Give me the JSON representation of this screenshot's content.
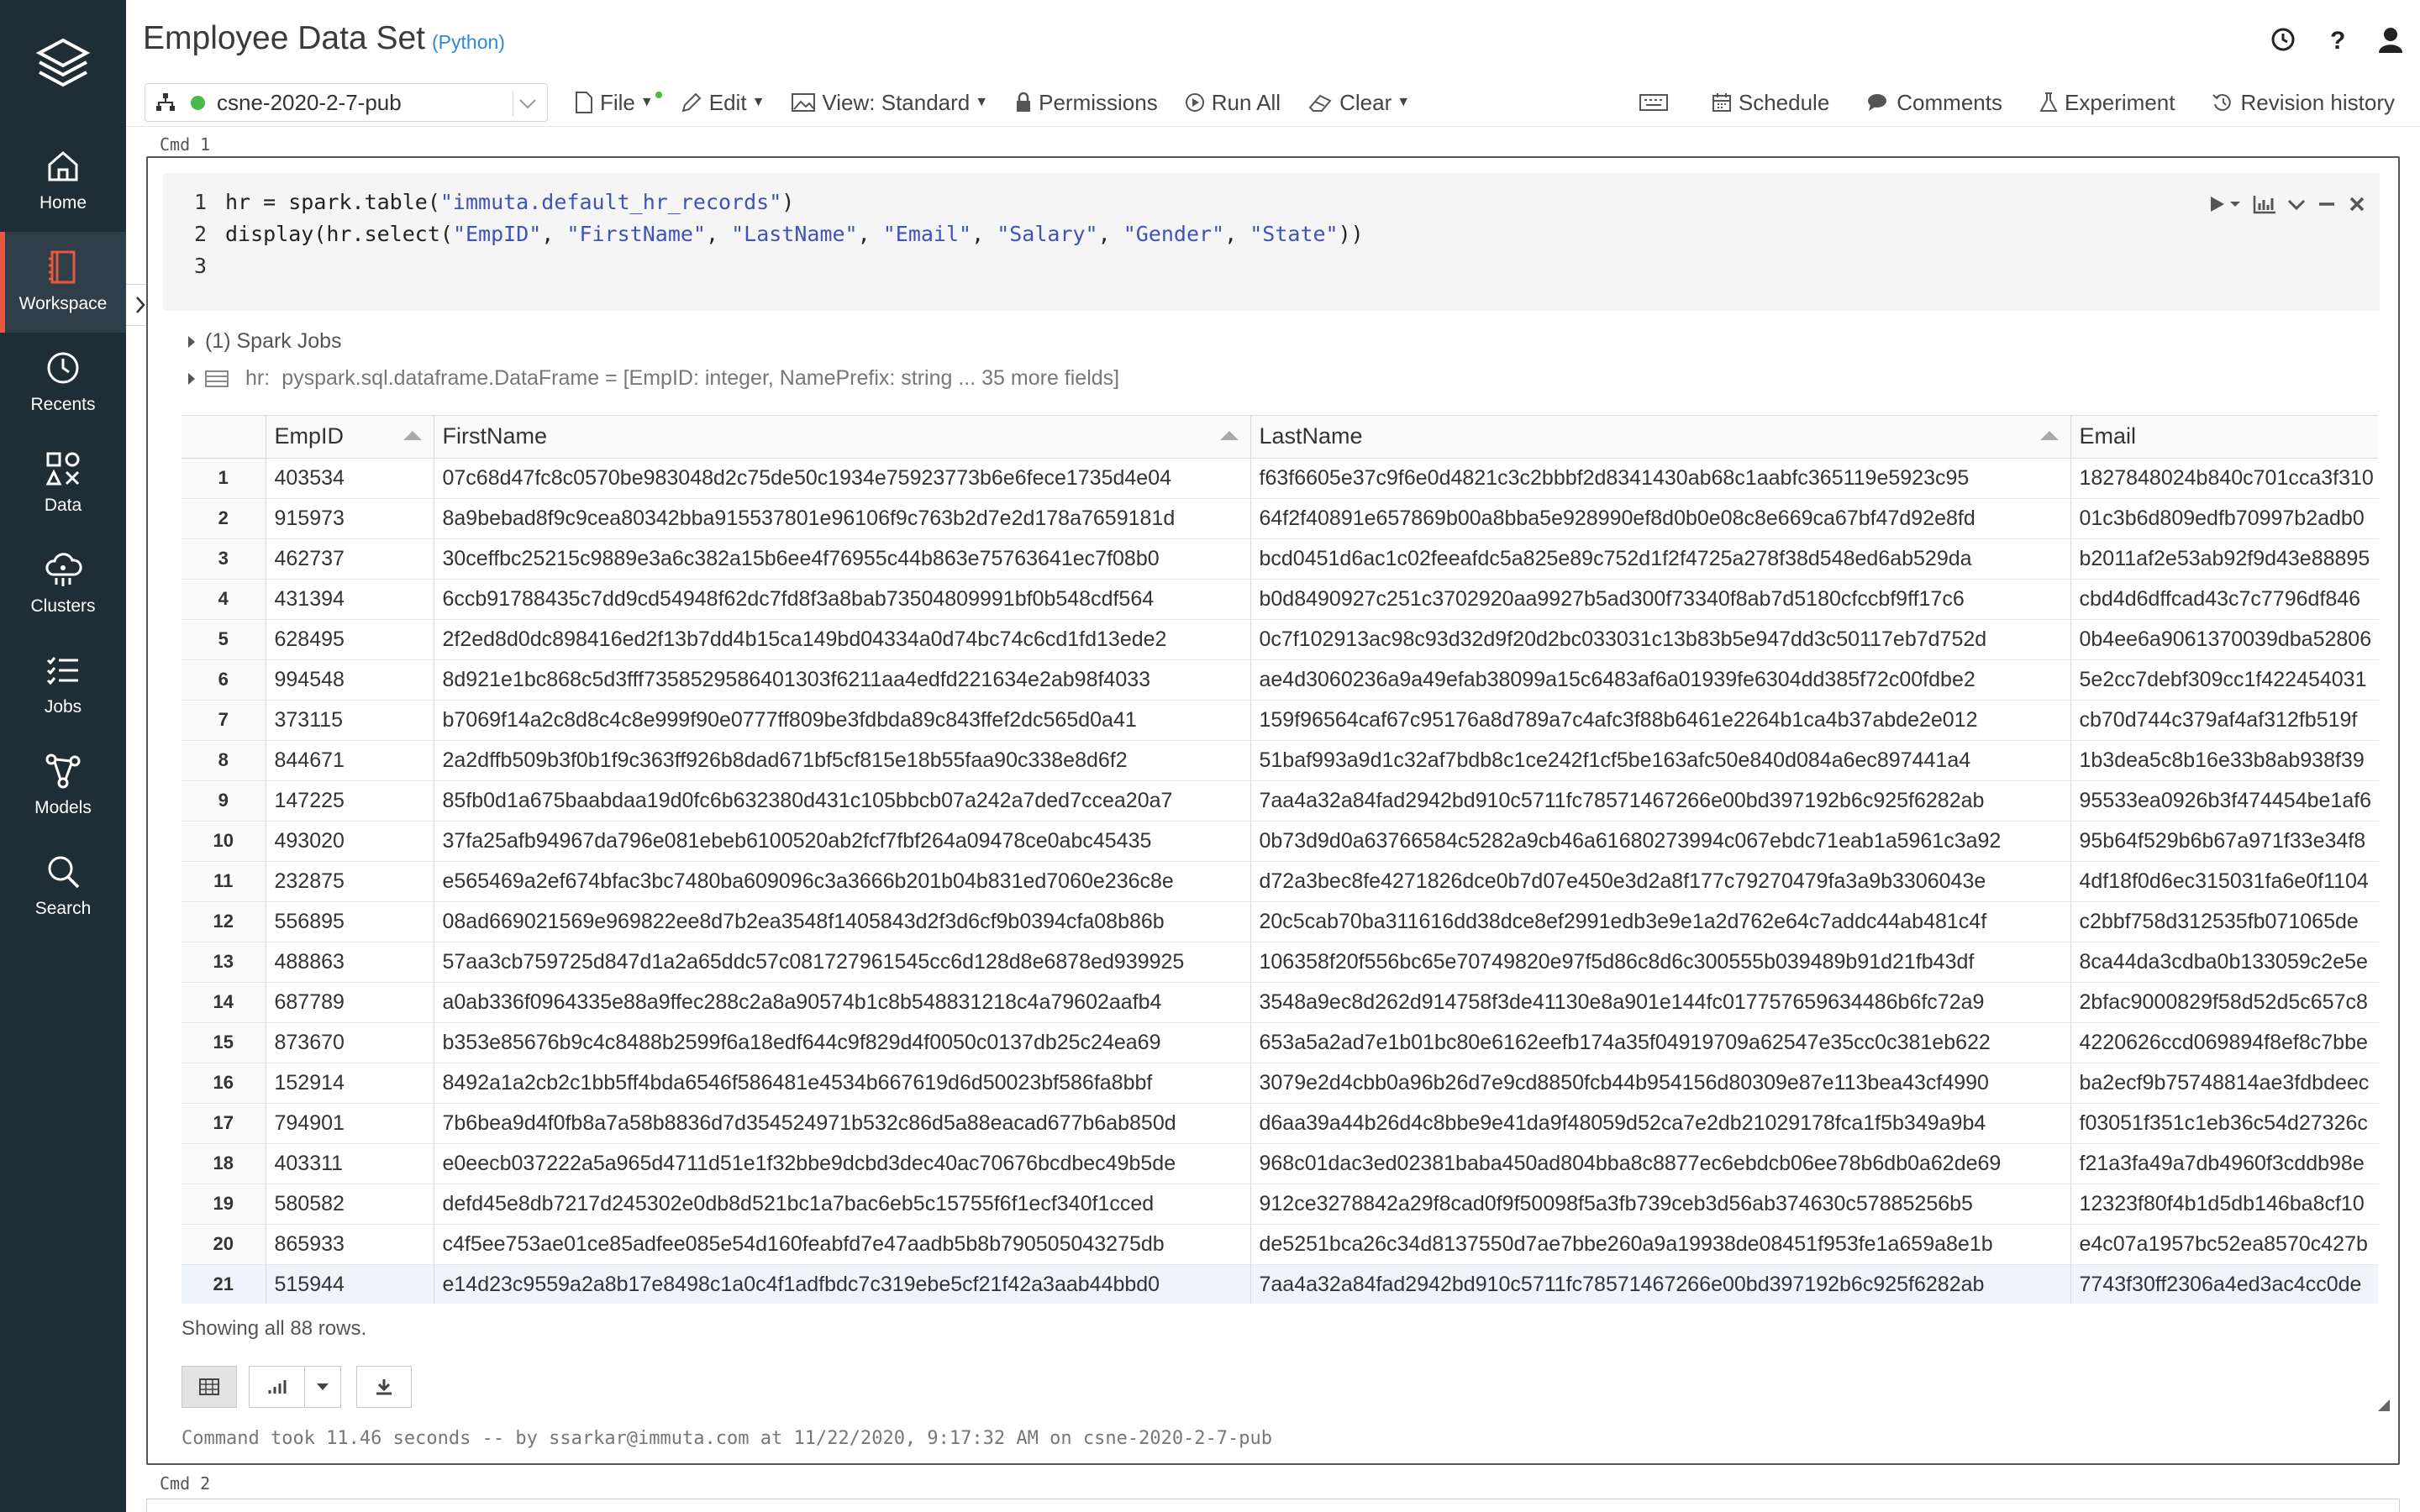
{
  "sidebar": {
    "items": [
      {
        "label": "Home",
        "icon": "home-icon",
        "active": false
      },
      {
        "label": "Workspace",
        "icon": "workspace-icon",
        "active": true
      },
      {
        "label": "Recents",
        "icon": "clock-icon",
        "active": false
      },
      {
        "label": "Data",
        "icon": "data-icon",
        "active": false
      },
      {
        "label": "Clusters",
        "icon": "clusters-icon",
        "active": false
      },
      {
        "label": "Jobs",
        "icon": "jobs-icon",
        "active": false
      },
      {
        "label": "Models",
        "icon": "models-icon",
        "active": false
      },
      {
        "label": "Search",
        "icon": "search-icon",
        "active": false
      }
    ]
  },
  "header": {
    "title": "Employee Data Set",
    "language": "(Python)"
  },
  "toolbar": {
    "cluster": "csne-2020-2-7-pub",
    "file": "File",
    "edit": "Edit",
    "view": "View: Standard",
    "permissions": "Permissions",
    "run_all": "Run All",
    "clear": "Clear",
    "schedule": "Schedule",
    "comments": "Comments",
    "experiment": "Experiment",
    "revision_history": "Revision history"
  },
  "cell": {
    "cmd_label": "Cmd 1",
    "code": [
      {
        "n": "1",
        "pre": "hr = spark.table(",
        "s1": "\"immuta.default_hr_records\"",
        "post": ")"
      },
      {
        "n": "2",
        "pre": "display(hr.select(",
        "args": [
          "\"EmpID\"",
          "\"FirstName\"",
          "\"LastName\"",
          "\"Email\"",
          "\"Salary\"",
          "\"Gender\"",
          "\"State\""
        ],
        "post": "))"
      },
      {
        "n": "3"
      }
    ],
    "spark_jobs": "(1) Spark Jobs",
    "df_label": "hr:",
    "df_desc": "pyspark.sql.dataframe.DataFrame = [EmpID: integer, NamePrefix: string ... 35 more fields]",
    "columns": [
      "",
      "EmpID",
      "FirstName",
      "LastName",
      "Email"
    ],
    "rows": [
      [
        "1",
        "403534",
        "07c68d47fc8c0570be983048d2c75de50c1934e75923773b6e6fece1735d4e04",
        "f63f6605e37c9f6e0d4821c3c2bbbf2d8341430ab68c1aabfc365119e5923c95",
        "1827848024b840c701cca3f310"
      ],
      [
        "2",
        "915973",
        "8a9bebad8f9c9cea80342bba915537801e96106f9c763b2d7e2d178a7659181d",
        "64f2f40891e657869b00a8bba5e928990ef8d0b0e08c8e669ca67bf47d92e8fd",
        "01c3b6d809edfb70997b2adb0"
      ],
      [
        "3",
        "462737",
        "30ceffbc25215c9889e3a6c382a15b6ee4f76955c44b863e75763641ec7f08b0",
        "bcd0451d6ac1c02feeafdc5a825e89c752d1f2f4725a278f38d548ed6ab529da",
        "b2011af2e53ab92f9d43e88895"
      ],
      [
        "4",
        "431394",
        "6ccb91788435c7dd9cd54948f62dc7fd8f3a8bab73504809991bf0b548cdf564",
        "b0d8490927c251c3702920aa9927b5ad300f73340f8ab7d5180cfccbf9ff17c6",
        "cbd4d6dffcad43c7c7796df846"
      ],
      [
        "5",
        "628495",
        "2f2ed8d0dc898416ed2f13b7dd4b15ca149bd04334a0d74bc74c6cd1fd13ede2",
        "0c7f102913ac98c93d32d9f20d2bc033031c13b83b5e947dd3c50117eb7d752d",
        "0b4ee6a9061370039dba52806"
      ],
      [
        "6",
        "994548",
        "8d921e1bc868c5d3fff7358529586401303f6211aa4edfd221634e2ab98f4033",
        "ae4d3060236a9a49efab38099a15c6483af6a01939fe6304dd385f72c00fdbe2",
        "5e2cc7debf309cc1f422454031"
      ],
      [
        "7",
        "373115",
        "b7069f14a2c8d8c4c8e999f90e0777ff809be3fdbda89c843ffef2dc565d0a41",
        "159f96564caf67c95176a8d789a7c4afc3f88b6461e2264b1ca4b37abde2e012",
        "cb70d744c379af4af312fb519f"
      ],
      [
        "8",
        "844671",
        "2a2dffb509b3f0b1f9c363ff926b8dad671bf5cf815e18b55faa90c338e8d6f2",
        "51baf993a9d1c32af7bdb8c1ce242f1cf5be163afc50e840d084a6ec897441a4",
        "1b3dea5c8b16e33b8ab938f39"
      ],
      [
        "9",
        "147225",
        "85fb0d1a675baabdaa19d0fc6b632380d431c105bbcb07a242a7ded7ccea20a7",
        "7aa4a32a84fad2942bd910c5711fc78571467266e00bd397192b6c925f6282ab",
        "95533ea0926b3f474454be1af6"
      ],
      [
        "10",
        "493020",
        "37fa25afb94967da796e081ebeb6100520ab2fcf7fbf264a09478ce0abc45435",
        "0b73d9d0a63766584c5282a9cb46a61680273994c067ebdc71eab1a5961c3a92",
        "95b64f529b6b67a971f33e34f8"
      ],
      [
        "11",
        "232875",
        "e565469a2ef674bfac3bc7480ba609096c3a3666b201b04b831ed7060e236c8e",
        "d72a3bec8fe4271826dce0b7d07e450e3d2a8f177c79270479fa3a9b3306043e",
        "4df18f0d6ec315031fa6e0f1104"
      ],
      [
        "12",
        "556895",
        "08ad669021569e969822ee8d7b2ea3548f1405843d2f3d6cf9b0394cfa08b86b",
        "20c5cab70ba311616dd38dce8ef2991edb3e9e1a2d762e64c7addc44ab481c4f",
        "c2bbf758d312535fb071065de"
      ],
      [
        "13",
        "488863",
        "57aa3cb759725d847d1a2a65ddc57c081727961545cc6d128d8e6878ed939925",
        "106358f20f556bc65e70749820e97f5d86c8d6c300555b039489b91d21fb43df",
        "8ca44da3cdba0b133059c2e5e"
      ],
      [
        "14",
        "687789",
        "a0ab336f0964335e88a9ffec288c2a8a90574b1c8b548831218c4a79602aafb4",
        "3548a9ec8d262d914758f3de41130e8a901e144fc017757659634486b6fc72a9",
        "2bfac9000829f58d52d5c657c8"
      ],
      [
        "15",
        "873670",
        "b353e85676b9c4c8488b2599f6a18edf644c9f829d4f0050c0137db25c24ea69",
        "653a5a2ad7e1b01bc80e6162eefb174a35f04919709a62547e35cc0c381eb622",
        "4220626ccd069894f8ef8c7bbe"
      ],
      [
        "16",
        "152914",
        "8492a1a2cb2c1bb5ff4bda6546f586481e4534b667619d6d50023bf586fa8bbf",
        "3079e2d4cbb0a96b26d7e9cd8850fcb44b954156d80309e87e113bea43cf4990",
        "ba2ecf9b75748814ae3fdbdeec"
      ],
      [
        "17",
        "794901",
        "7b6bea9d4f0fb8a7a58b8836d7d354524971b532c86d5a88eacad677b6ab850d",
        "d6aa39a44b26d4c8bbe9e41da9f48059d52ca7e2db21029178fca1f5b349a9b4",
        "f03051f351c1eb36c54d27326c"
      ],
      [
        "18",
        "403311",
        "e0eecb037222a5a965d4711d51e1f32bbe9dcbd3dec40ac70676bcdbec49b5de",
        "968c01dac3ed02381baba450ad804bba8c8877ec6ebdcb06ee78b6db0a62de69",
        "f21a3fa49a7db4960f3cddb98e"
      ],
      [
        "19",
        "580582",
        "defd45e8db7217d245302e0db8d521bc1a7bac6eb5c15755f6f1ecf340f1cced",
        "912ce3278842a29f8cad0f9f50098f5a3fb739ceb3d56ab374630c57885256b5",
        "12323f80f4b1d5db146ba8cf10"
      ],
      [
        "20",
        "865933",
        "c4f5ee753ae01ce85adfee085e54d160feabfd7e47aadb5b8b790505043275db",
        "de5251bca26c34d8137550d7ae7bbe260a9a19938de08451f953fe1a659a8e1b",
        "e4c07a1957bc52ea8570c427b"
      ],
      [
        "21",
        "515944",
        "e14d23c9559a2a8b17e8498c1a0c4f1adfbdc7c319ebe5cf21f42a3aab44bbd0",
        "7aa4a32a84fad2942bd910c5711fc78571467266e00bd397192b6c925f6282ab",
        "7743f30ff2306a4ed3ac4cc0de"
      ]
    ],
    "rows_info": "Showing all 88 rows.",
    "command_took": "Command took 11.46 seconds -- by ssarkar@immuta.com at 11/22/2020, 9:17:32 AM on csne-2020-2-7-pub"
  },
  "cell2": {
    "cmd_label": "Cmd 2"
  },
  "colors": {
    "sidebar_bg": "#1f2d36",
    "accent": "#e8573f",
    "cluster_dot": "#4cba4a",
    "string": "#3e53b9"
  }
}
